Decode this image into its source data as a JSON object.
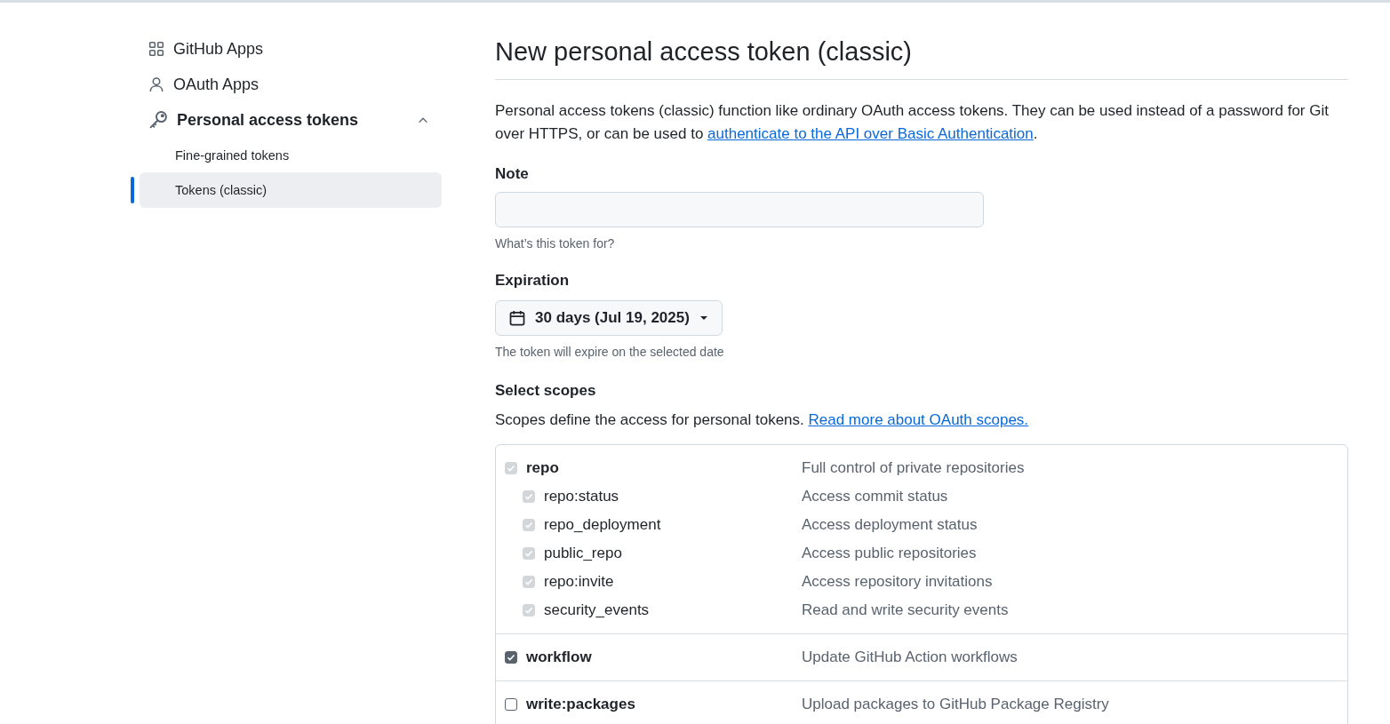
{
  "sidebar": {
    "items": [
      {
        "kind": "apps",
        "label": "GitHub Apps",
        "expanded": false
      },
      {
        "kind": "person",
        "label": "OAuth Apps",
        "expanded": false
      },
      {
        "kind": "key",
        "label": "Personal access tokens",
        "expanded": true,
        "children": [
          {
            "label": "Fine-grained tokens",
            "selected": false
          },
          {
            "label": "Tokens (classic)",
            "selected": true
          }
        ]
      }
    ]
  },
  "main": {
    "title": "New personal access token (classic)",
    "intro": {
      "text": "Personal access tokens (classic) function like ordinary OAuth access tokens. They can be used instead of a password for Git over HTTPS, or can be used to ",
      "link": "authenticate to the API over Basic Authentication",
      "end": "."
    },
    "note": {
      "label": "Note",
      "hint": "What’s this token for?"
    },
    "expiration": {
      "label": "Expiration",
      "value": "30 days (Jul 19, 2025)",
      "hint": "The token will expire on the selected date"
    },
    "scopes": {
      "title": "Select scopes",
      "description": "Scopes define the access for personal tokens. ",
      "link": "Read more about OAuth scopes.",
      "groups": [
        {
          "name": "repo",
          "description": "Full control of private repositories",
          "checked": true,
          "disabled": true,
          "children": [
            {
              "name": "repo:status",
              "description": "Access commit status",
              "checked": true,
              "disabled": true
            },
            {
              "name": "repo_deployment",
              "description": "Access deployment status",
              "checked": true,
              "disabled": true
            },
            {
              "name": "public_repo",
              "description": "Access public repositories",
              "checked": true,
              "disabled": true
            },
            {
              "name": "repo:invite",
              "description": "Access repository invitations",
              "checked": true,
              "disabled": true
            },
            {
              "name": "security_events",
              "description": "Read and write security events",
              "checked": true,
              "disabled": true
            }
          ]
        },
        {
          "name": "workflow",
          "description": "Update GitHub Action workflows",
          "checked": true,
          "disabled": false
        },
        {
          "name": "write:packages",
          "description": "Upload packages to GitHub Package Registry",
          "checked": false,
          "disabled": false
        }
      ]
    }
  }
}
